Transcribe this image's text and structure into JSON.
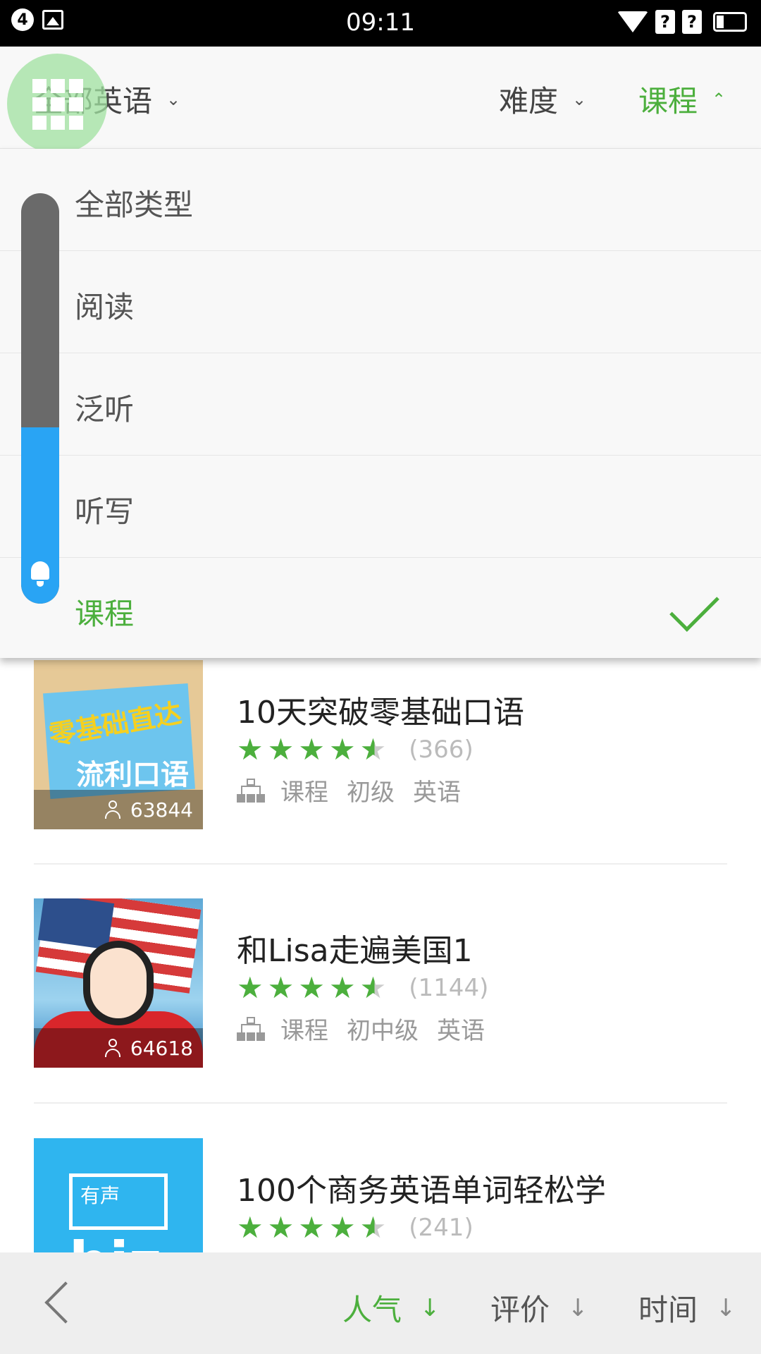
{
  "status_bar": {
    "notification_count": "4",
    "time": "09:11",
    "sim1": "?",
    "sim2": "?"
  },
  "filters": {
    "language": "全部英语",
    "difficulty": "难度",
    "type": "课程"
  },
  "dropdown": {
    "items": [
      {
        "label": "全部类型",
        "selected": false
      },
      {
        "label": "阅读",
        "selected": false
      },
      {
        "label": "泛听",
        "selected": false
      },
      {
        "label": "听写",
        "selected": false
      },
      {
        "label": "课程",
        "selected": true
      }
    ]
  },
  "volume_level": 0.43,
  "courses": [
    {
      "title": "10天突破零基础口语",
      "learners": "63844",
      "rating": 4.5,
      "rating_count": "(366)",
      "tags": [
        "课程",
        "初级",
        "英语"
      ],
      "thumb_text_1": "零基础直达",
      "thumb_text_2": "流利口语"
    },
    {
      "title": "和Lisa走遍美国1",
      "learners": "64618",
      "rating": 4.5,
      "rating_count": "(1144)",
      "tags": [
        "课程",
        "初中级",
        "英语"
      ]
    },
    {
      "title": "100个商务英语单词轻松学",
      "rating": 4.5,
      "rating_count": "(241)",
      "thumb_text_1": "有声",
      "thumb_text_2": "biz"
    }
  ],
  "sort_bar": {
    "popularity": "人气",
    "rating": "评价",
    "time": "时间",
    "arrow": "↓"
  },
  "colors": {
    "accent": "#4caf3d",
    "volume_fill": "#29a4f4"
  }
}
